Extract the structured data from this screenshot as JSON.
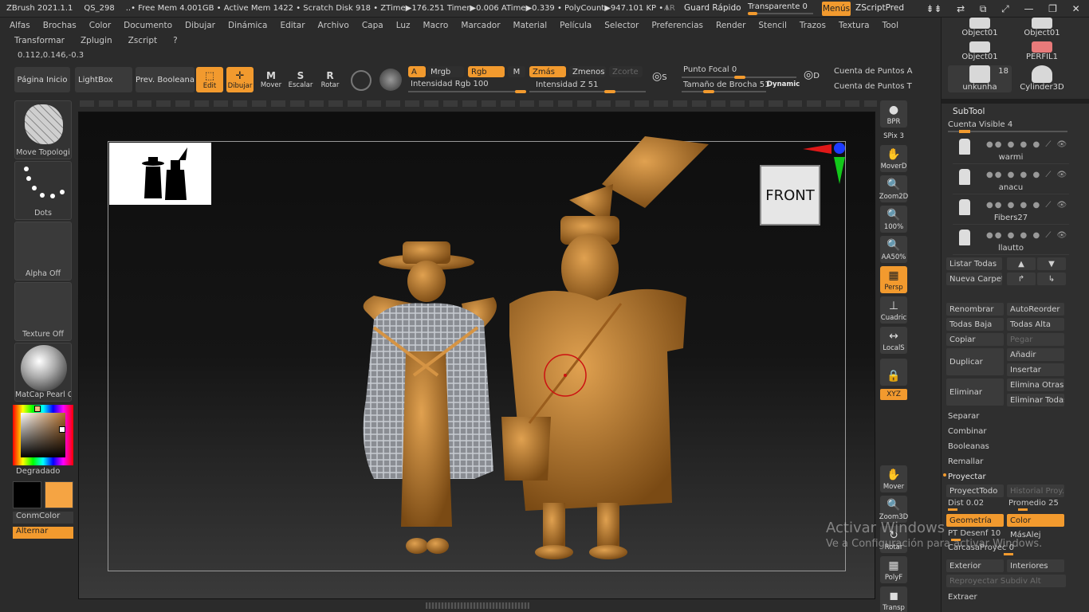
{
  "titlebar": {
    "app": "ZBrush 2021.1.1",
    "file": "QS_298",
    "status": "..• Free Mem 4.001GB • Active Mem 1422 • Scratch Disk 918 • ZTime▶176.251 Timer▶0.006 ATime▶0.339 • PolyCount▶947.101 KP • I",
    "ar": "AR",
    "quick_save": "Guard Rápido",
    "transparency_label": "Transparente 0",
    "menus": "Menús",
    "zscript": "ZScriptPred"
  },
  "menubar": [
    "Alfas",
    "Brochas",
    "Color",
    "Documento",
    "Dibujar",
    "Dinámica",
    "Editar",
    "Archivo",
    "Capa",
    "Luz",
    "Macro",
    "Marcador",
    "Material",
    "Película",
    "Selector",
    "Preferencias",
    "Render",
    "Stencil",
    "Trazos",
    "Textura",
    "Tool"
  ],
  "menubar_extra": [
    "Transformar",
    "Zplugin",
    "Zscript",
    "?"
  ],
  "coords": "0.112,0.146,-0.3",
  "topshelf": {
    "home": "Página Inicio",
    "lightbox": "LightBox",
    "prev_boolean": "Prev. Booleana",
    "edit": "Edit",
    "draw": "Dibujar",
    "move": "Mover",
    "scale": "Escalar",
    "rotate": "Rotar",
    "a": "A",
    "mrgb": "Mrgb",
    "rgb": "Rgb",
    "m": "M",
    "zadd": "Zmás",
    "zsub": "Zmenos",
    "zcut": "Zcorte",
    "rgb_intensity": "Intensidad Rgb 100",
    "rgb_intensity_value": 100,
    "z_intensity": "Intensidad Z 51",
    "z_intensity_value": 51,
    "focal": "Punto Focal 0",
    "brush_size": "Tamaño de Brocha 51",
    "dynamic": "Dynamic",
    "points_a": "Cuenta de Puntos A",
    "points_t": "Cuenta de Puntos T"
  },
  "leftpanel": {
    "brush": "Move Topologi",
    "stroke": "Dots",
    "alpha": "Alpha Off",
    "texture": "Texture Off",
    "material": "MatCap Pearl C",
    "gradient": "Degradado",
    "switch_color": "ConmColor",
    "alternate": "Alternar"
  },
  "viewport": {
    "front": "FRONT"
  },
  "rightbar": [
    {
      "label": "BPR",
      "icon": "bpr-icon"
    },
    {
      "label": "SPix 3",
      "icon": "spix-icon"
    },
    {
      "label": "MoverD",
      "icon": "hand-icon"
    },
    {
      "label": "Zoom2D",
      "icon": "zoom2d-icon"
    },
    {
      "label": "100%",
      "icon": "zoom-icon"
    },
    {
      "label": "AA50%",
      "icon": "aa-icon"
    },
    {
      "label": "Persp",
      "icon": "persp-icon"
    },
    {
      "label": "Cuadric",
      "icon": "floor-icon"
    },
    {
      "label": "LocalS",
      "icon": "local-icon"
    },
    {
      "label": "",
      "icon": "lock-icon"
    },
    {
      "label": "Mover",
      "icon": "move3d-icon"
    },
    {
      "label": "Zoom3D",
      "icon": "zoom3d-icon"
    },
    {
      "label": "Rotar",
      "icon": "rotate-icon"
    },
    {
      "label": "PolyF",
      "icon": "polyf-icon"
    },
    {
      "label": "Transp",
      "icon": "transp-icon"
    }
  ],
  "rightbar_xyz": "XYZ",
  "tray": {
    "tools": [
      {
        "name": "Object01"
      },
      {
        "name": "Object01"
      },
      {
        "name": "Object01"
      },
      {
        "name": "PERFIL1"
      },
      {
        "name": "unkunha",
        "count": "18"
      },
      {
        "name": "Cylinder3D"
      }
    ],
    "subtool_title": "SubTool",
    "visible_count": "Cuenta Visible 4",
    "visible_count_value": 4,
    "subtools": [
      "warmi",
      "anacu",
      "Fibers27",
      "llautto"
    ],
    "list_all": "Listar Todas",
    "new_folder": "Nueva Carpeta",
    "rename": "Renombrar",
    "auto_reorder": "AutoReorder",
    "all_low": "Todas Baja",
    "all_high": "Todas Alta",
    "copy": "Copiar",
    "paste": "Pegar",
    "duplicate": "Duplicar",
    "append": "Añadir",
    "insert": "Insertar",
    "delete": "Eliminar",
    "delete_other": "Elimina Otras",
    "delete_all": "Eliminar Todas",
    "split": "Separar",
    "merge": "Combinar",
    "boolean": "Booleanas",
    "remesh": "Remallar",
    "project": "Proyectar",
    "project_all": "ProyectTodo",
    "project_history": "Historial Proy.",
    "dist": "Dist 0.02",
    "mean": "Promedio 25",
    "geometry": "Geometría",
    "color": "Color",
    "pt_blur": "PT Desenf 10",
    "farthest": "MásAlej",
    "shell": "CarcasaProyec 0",
    "outer": "Exterior",
    "inner": "Interiores",
    "reproject": "Reproyectar Subdiv Alt",
    "extract": "Extraer"
  },
  "watermark": {
    "line1": "Activar Windows",
    "line2": "Ve a Configuración para activar Windows."
  }
}
